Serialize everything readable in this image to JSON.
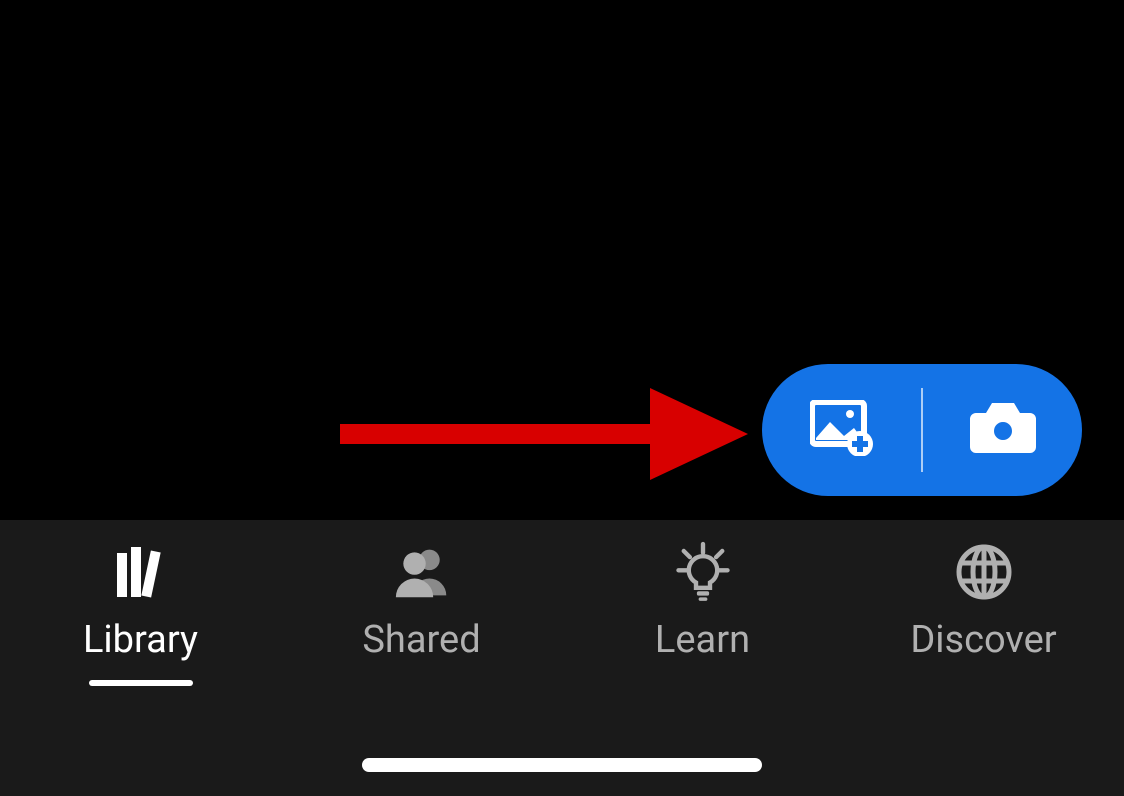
{
  "fab": {
    "add_photo_icon": "add-photo-icon",
    "camera_icon": "camera-icon"
  },
  "annotation": {
    "arrow": "red-arrow"
  },
  "nav": {
    "items": [
      {
        "label": "Library",
        "icon": "library-icon",
        "active": true
      },
      {
        "label": "Shared",
        "icon": "people-icon",
        "active": false
      },
      {
        "label": "Learn",
        "icon": "lightbulb-icon",
        "active": false
      },
      {
        "label": "Discover",
        "icon": "globe-icon",
        "active": false
      }
    ]
  }
}
